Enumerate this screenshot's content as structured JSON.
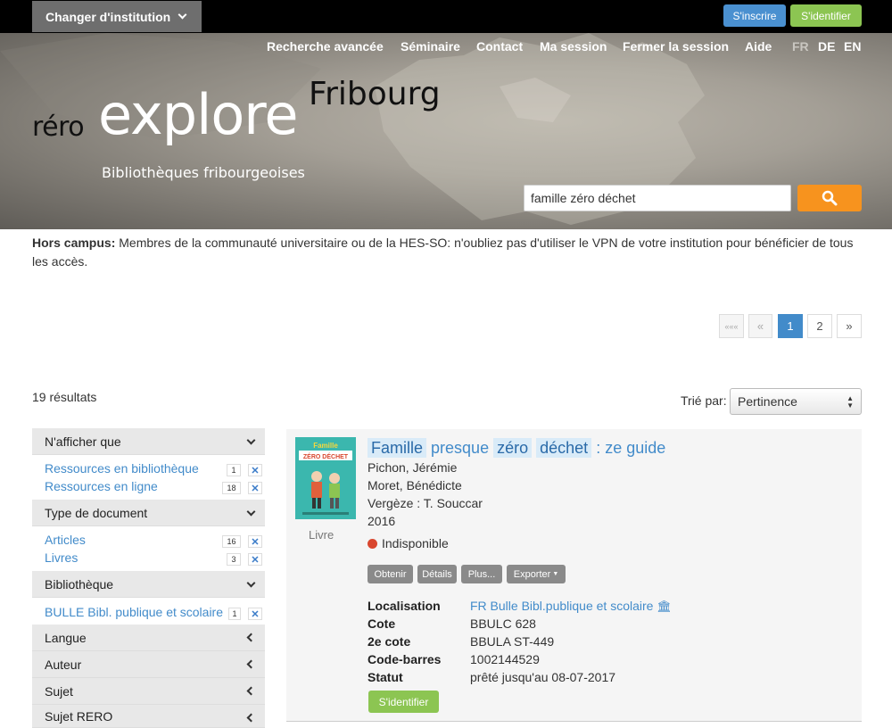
{
  "topbar": {
    "institution_label": "Changer d'institution",
    "signup_label": "S'inscrire",
    "login_label": "S'identifier"
  },
  "nav": {
    "items": [
      "Recherche avancée",
      "Séminaire",
      "Contact",
      "Ma session",
      "Fermer la session",
      "Aide"
    ],
    "languages": [
      "FR",
      "DE",
      "EN"
    ],
    "active_language": "FR"
  },
  "logo": {
    "rero": "réro",
    "explore": "explore",
    "city": "Fribourg",
    "subtitle": "Bibliothèques fribourgeoises"
  },
  "search": {
    "value": "famille zéro déchet",
    "button_icon": "search-icon"
  },
  "notice": {
    "label": "Hors campus:",
    "text": " Membres de la communauté universitaire ou de la HES-SO: n'oubliez pas d'utiliser le VPN de votre institution pour bénéficier de tous les accès."
  },
  "pagination": {
    "first": "«««",
    "prev": "«",
    "pages": [
      "1",
      "2"
    ],
    "current_page": "1",
    "next": "»"
  },
  "results": {
    "count_label": "19 résultats",
    "sort_label": "Trié par:",
    "sort_value": "Pertinence"
  },
  "facets": {
    "show_only": {
      "heading": "N'afficher que",
      "items": [
        {
          "label": "Ressources en bibliothèque",
          "count": "1"
        },
        {
          "label": "Ressources en ligne",
          "count": "18"
        }
      ]
    },
    "doc_type": {
      "heading": "Type de document",
      "items": [
        {
          "label": "Articles",
          "count": "16"
        },
        {
          "label": "Livres",
          "count": "3"
        }
      ]
    },
    "library": {
      "heading": "Bibliothèque",
      "items": [
        {
          "label": "BULLE Bibl. publique et scolaire",
          "count": "1"
        }
      ]
    },
    "collapsed": [
      "Langue",
      "Auteur",
      "Sujet",
      "Sujet RERO"
    ]
  },
  "record": {
    "title_words": [
      "Famille",
      "presque",
      "zéro",
      "déchet",
      ": ze guide"
    ],
    "authors": [
      "Pichon, Jérémie",
      "Moret, Bénédicte"
    ],
    "publisher": "Vergèze : T. Souccar",
    "year": "2016",
    "type": "Livre",
    "availability": "Indisponible",
    "availability_color": "#d9472f",
    "actions": [
      "Obtenir",
      "Détails",
      "Plus...",
      "Exporter"
    ],
    "cover_title_line1": "Famille",
    "cover_title_line2": "ZÉRO DÉCHET",
    "holding": {
      "labels": [
        "Localisation",
        "Cote",
        "2e cote",
        "Code-barres",
        "Statut"
      ],
      "location": "FR Bulle Bibl.publique et scolaire",
      "call_number": "BBULC 628",
      "second_call_number": "BBULA ST-449",
      "barcode": "1002144529",
      "status": "prêté jusqu'au 08-07-2017",
      "login_label": "S'identifier"
    }
  },
  "colors": {
    "accent_blue": "#428bca",
    "green": "#8cc552",
    "orange": "#f7931e",
    "status_red": "#d9472f"
  }
}
